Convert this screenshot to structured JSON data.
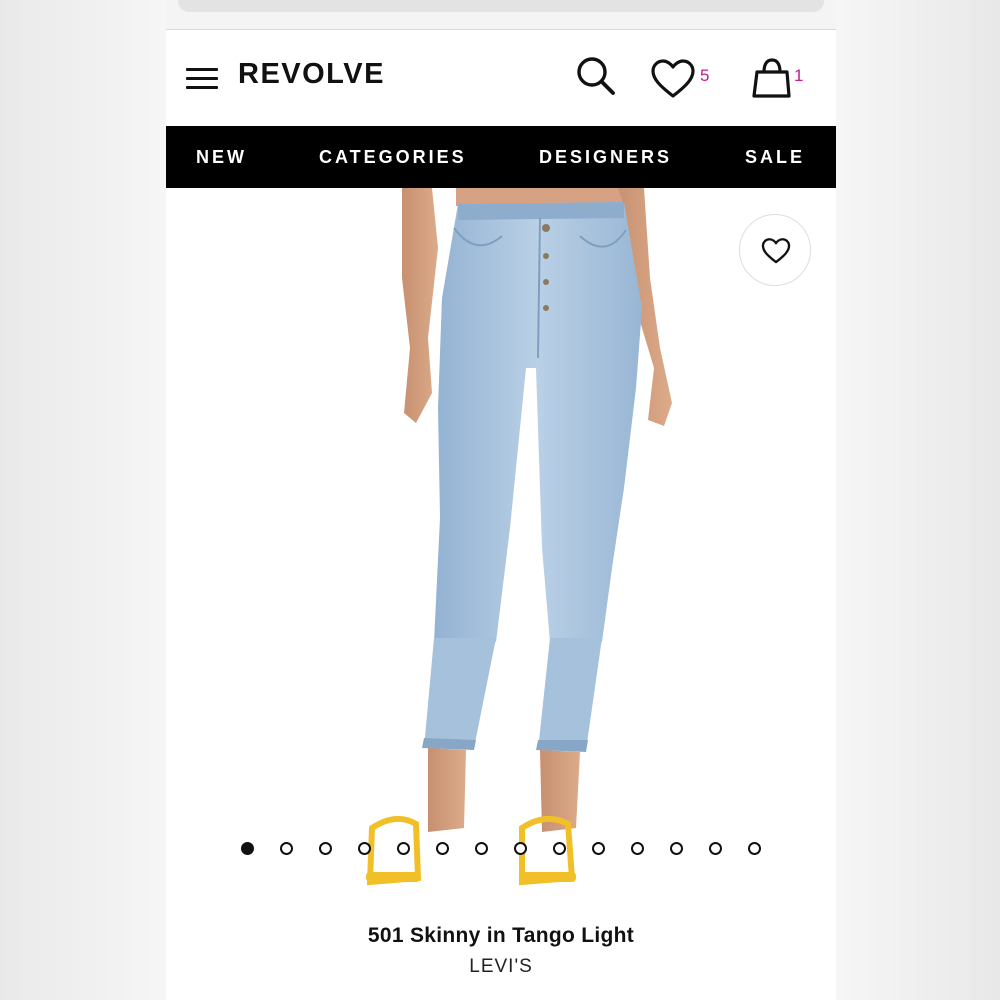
{
  "header": {
    "logo": "REVOLVE",
    "wishlist_count": "5",
    "bag_count": "1"
  },
  "nav": {
    "items": [
      "NEW",
      "CATEGORIES",
      "DESIGNERS",
      "SALE"
    ]
  },
  "carousel": {
    "total_slides": 14,
    "active_slide": 1
  },
  "product": {
    "title": "501 Skinny in Tango Light",
    "brand": "LEVI'S"
  },
  "colors": {
    "accent": "#c2208a",
    "nav_bg": "#000000",
    "denim": "#a9c4df"
  }
}
